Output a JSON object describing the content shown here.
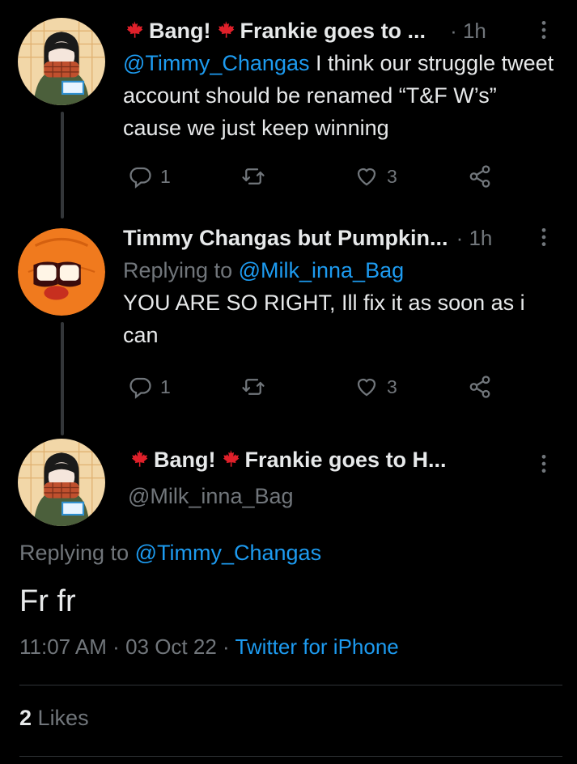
{
  "tweet1": {
    "name_part1": "Bang!",
    "name_part2": "Frankie goes to ...",
    "time": "· 1h",
    "mention": "@Timmy_Changas",
    "text": " I think our struggle tweet account should be renamed “T&F W’s” cause we just keep winning",
    "replies": "1",
    "likes": "3"
  },
  "tweet2": {
    "name": "Timmy Changas but Pumpkin...",
    "time": "· 1h",
    "replying_prefix": "Replying to ",
    "replying_handle": "@Milk_inna_Bag",
    "text": "YOU ARE SO RIGHT, Ill fix it as soon as i can",
    "replies": "1",
    "likes": "3"
  },
  "main": {
    "name_part1": "Bang!",
    "name_part2": "Frankie goes to H...",
    "handle": "@Milk_inna_Bag",
    "replying_prefix": "Replying to ",
    "replying_handle": "@Timmy_Changas",
    "text": "Fr fr",
    "time": "11:07 AM",
    "date": "03 Oct 22",
    "source": "Twitter for iPhone",
    "likes_count": "2",
    "likes_label": "Likes"
  },
  "icons": {
    "reply": "reply-icon",
    "retweet": "retweet-icon",
    "like": "heart-icon",
    "share": "share-icon",
    "more": "more-icon",
    "flag": "maple-leaf-icon"
  },
  "colors": {
    "background": "#000000",
    "text": "#e7e9ea",
    "muted": "#71767b",
    "link": "#1d9bf0",
    "leaf": "#e0202a"
  }
}
